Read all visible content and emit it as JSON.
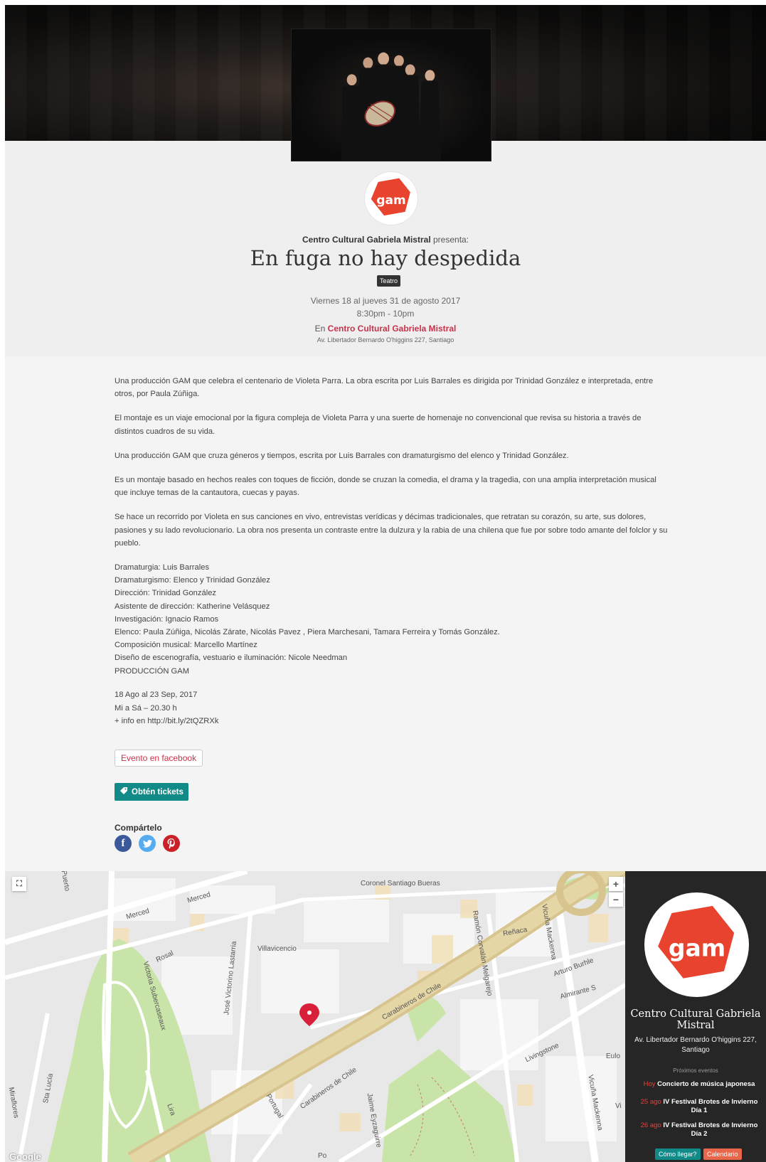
{
  "hero": {
    "image_alt": "Cast photo of five performers dressed in black holding a drum"
  },
  "header": {
    "presenter_name": "Centro Cultural Gabriela Mistral",
    "presenter_suffix": "presenta:",
    "title": "En fuga no hay despedida",
    "category": "Teatro",
    "dates": "Viernes 18 al jueves 31 de agosto 2017",
    "times": "8:30pm - 10pm",
    "venue_prefix": "En",
    "venue_name": "Centro Cultural Gabriela Mistral",
    "address": "Av. Libertador Bernardo O'higgins 227, Santiago"
  },
  "description": {
    "paragraphs": [
      "Una producción GAM que celebra el centenario de Violeta Parra. La obra escrita por Luis Barrales es dirigida por Trinidad González e interpretada, entre otros, por Paula Zúñiga.",
      "El montaje es un viaje emocional por la figura compleja de Violeta Parra y una suerte de homenaje no convencional que revisa su historia a través de distintos cuadros de su vida.",
      "Una producción GAM que cruza géneros y tiempos, escrita por Luis Barrales con dramaturgismo del elenco y Trinidad González.",
      "Es un montaje basado en hechos reales con toques de ficción, donde se cruzan la comedia, el drama y la tragedia, con una amplia interpretación musical que incluye temas de la cantautora, cuecas y payas.",
      "Se hace un recorrido por Violeta en sus canciones en vivo, entrevistas verídicas y décimas tradicionales, que retratan su corazón, su arte, sus dolores, pasiones y su lado revolucionario. La obra nos presenta un contraste entre la dulzura y la rabia de una chilena que fue por sobre todo amante del folclor y su pueblo."
    ],
    "credits": [
      "Dramaturgia: Luis Barrales",
      "Dramaturgismo: Elenco y Trinidad González",
      "Dirección: Trinidad González",
      "Asistente de dirección: Katherine Velásquez",
      "Investigación: Ignacio Ramos",
      "Elenco: Paula Zúñiga, Nicolás Zárate, Nicolás Pavez , Piera Marchesani, Tamara Ferreira y Tomás González.",
      "Composición musical: Marcello Martínez",
      "Diseño de escenografía, vestuario e iluminación: Nicole Needman",
      "PRODUCCIÓN GAM"
    ],
    "schedule": [
      "18 Ago al 23 Sep, 2017",
      "Mi a Sá – 20.30 h",
      "+ info en http://bit.ly/2tQZRXk"
    ]
  },
  "actions": {
    "facebook_event": "Evento en facebook",
    "tickets": "Obtén tickets",
    "share_label": "Compártelo",
    "share_icons": [
      "facebook-icon",
      "twitter-icon",
      "pinterest-icon"
    ]
  },
  "map": {
    "streets": [
      "Merced",
      "Merced",
      "Coronel Santiago Bueras",
      "Rosal",
      "Villavicencio",
      "José Victorino Lastarria",
      "Victoria Subercaseaux",
      "Ramón Corvalán Melgarejo",
      "Vicuña Mackenna",
      "Reñaca",
      "Arturo Burhle",
      "Almirante S",
      "Carabineros de Chile",
      "Carabineros de Chile",
      "Livingstone",
      "Eulo",
      "Vicuña Mackenna",
      "Portugal",
      "Jaime Eyzaguirre",
      "Lira",
      "Sta Lucía",
      "Miraflores",
      "Po",
      "Vi",
      "Puerto"
    ],
    "attribution": "Google",
    "zoom_in": "+",
    "zoom_out": "−"
  },
  "venue_card": {
    "name": "Centro Cultural Gabriela Mistral",
    "address": "Av. Libertador Bernardo O'higgins 227, Santiago",
    "upcoming_label": "Próximos eventos",
    "events": [
      {
        "date": "Hoy",
        "name": "Concierto de música japonesa"
      },
      {
        "date": "25 ago",
        "name": "IV Festival Brotes de Invierno Día 1"
      },
      {
        "date": "26 ago",
        "name": "IV Festival Brotes de Invierno Día 2"
      }
    ],
    "directions_button": "Cómo llegar?",
    "calendar_button": "Calendario"
  },
  "colors": {
    "accent_red": "#c8324a",
    "teal": "#128a87",
    "logo_red": "#e8432f",
    "calendar_orange": "#e8664a"
  }
}
